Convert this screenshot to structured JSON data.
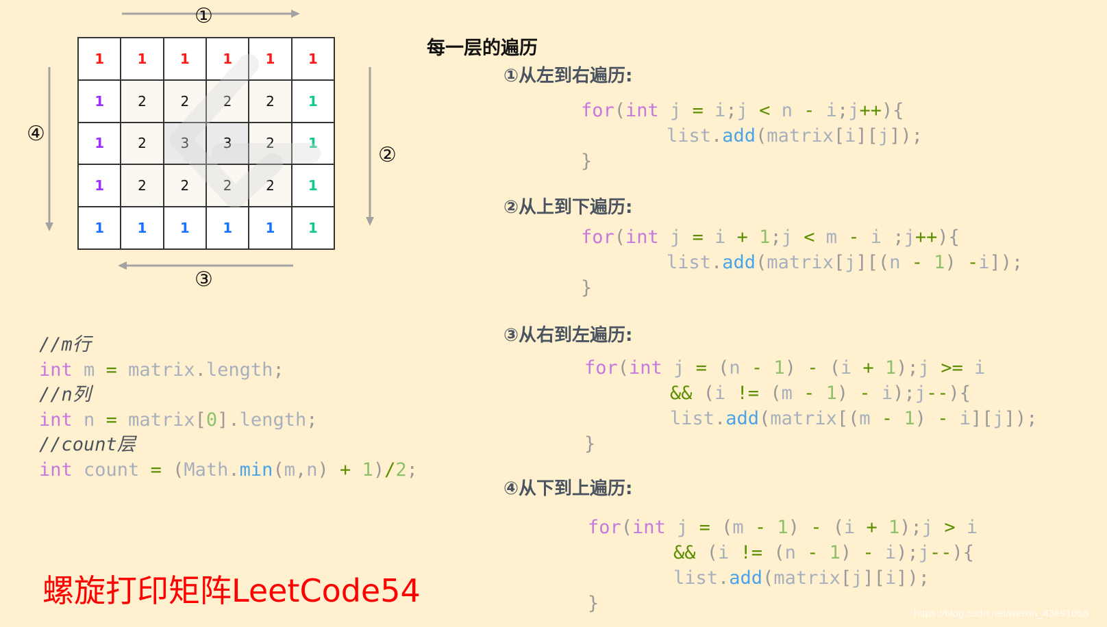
{
  "matrix": {
    "rows": [
      [
        1,
        1,
        1,
        1,
        1,
        1
      ],
      [
        1,
        2,
        2,
        2,
        2,
        1
      ],
      [
        1,
        2,
        3,
        3,
        2,
        1
      ],
      [
        1,
        2,
        2,
        2,
        2,
        1
      ],
      [
        1,
        1,
        1,
        1,
        1,
        1
      ]
    ],
    "colors": {
      "top": "#ff1a1a",
      "right": "#11c98a",
      "bottom": "#1a73ff",
      "left": "#9b30ff",
      "inner": "#111111"
    }
  },
  "arrows": {
    "top": {
      "label": "①",
      "direction": "right"
    },
    "right": {
      "label": "②",
      "direction": "down"
    },
    "bottom": {
      "label": "③",
      "direction": "left"
    },
    "left": {
      "label": "④",
      "direction": "down"
    }
  },
  "left_code": {
    "lines": [
      {
        "comment": "//m行"
      },
      {
        "tokens": [
          [
            "kw",
            "int"
          ],
          [
            "id",
            " m "
          ],
          [
            "op",
            "="
          ],
          [
            "id",
            " matrix"
          ],
          [
            "pn",
            "."
          ],
          [
            "id",
            "length"
          ],
          [
            "pn",
            ";"
          ]
        ]
      },
      {
        "comment": "//n列"
      },
      {
        "tokens": [
          [
            "kw",
            "int"
          ],
          [
            "id",
            " n "
          ],
          [
            "op",
            "="
          ],
          [
            "id",
            " matrix"
          ],
          [
            "pn",
            "["
          ],
          [
            "num",
            "0"
          ],
          [
            "pn",
            "]."
          ],
          [
            "id",
            "length"
          ],
          [
            "pn",
            ";"
          ]
        ]
      },
      {
        "comment": "//count层"
      },
      {
        "tokens": [
          [
            "kw",
            "int"
          ],
          [
            "id",
            " count "
          ],
          [
            "op",
            "="
          ],
          [
            "pn",
            " ("
          ],
          [
            "id",
            "Math"
          ],
          [
            "pn",
            "."
          ],
          [
            "fn",
            "min"
          ],
          [
            "pn",
            "("
          ],
          [
            "id",
            "m"
          ],
          [
            "pn",
            ","
          ],
          [
            "id",
            "n"
          ],
          [
            "pn",
            ")"
          ],
          [
            "op",
            " + "
          ],
          [
            "num",
            "1"
          ],
          [
            "pn",
            ")"
          ],
          [
            "op",
            "/"
          ],
          [
            "num",
            "2"
          ],
          [
            "pn",
            ";"
          ]
        ]
      }
    ]
  },
  "heading": "每一层的遍历",
  "sections": [
    {
      "title": "①从左到右遍历:",
      "lines": [
        [
          [
            "kw",
            "for"
          ],
          [
            "pn",
            "("
          ],
          [
            "kw",
            "int"
          ],
          [
            "id",
            " j "
          ],
          [
            "op",
            "="
          ],
          [
            "id",
            " i"
          ],
          [
            "pn",
            ";"
          ],
          [
            "id",
            "j "
          ],
          [
            "op",
            "<"
          ],
          [
            "id",
            " n "
          ],
          [
            "op",
            "-"
          ],
          [
            "id",
            " i"
          ],
          [
            "pn",
            ";"
          ],
          [
            "id",
            "j"
          ],
          [
            "op",
            "++"
          ],
          [
            "pn",
            "){"
          ]
        ],
        [
          [
            "id",
            "list"
          ],
          [
            "pn",
            "."
          ],
          [
            "fn",
            "add"
          ],
          [
            "pn",
            "("
          ],
          [
            "id",
            "matrix"
          ],
          [
            "pn",
            "["
          ],
          [
            "id",
            "i"
          ],
          [
            "pn",
            "]["
          ],
          [
            "id",
            "j"
          ],
          [
            "pn",
            "]);"
          ]
        ],
        [
          [
            "pn",
            "}"
          ]
        ]
      ]
    },
    {
      "title": "②从上到下遍历:",
      "lines": [
        [
          [
            "kw",
            "for"
          ],
          [
            "pn",
            "("
          ],
          [
            "kw",
            "int"
          ],
          [
            "id",
            " j "
          ],
          [
            "op",
            "="
          ],
          [
            "id",
            " i "
          ],
          [
            "op",
            "+"
          ],
          [
            "num",
            " 1"
          ],
          [
            "pn",
            ";"
          ],
          [
            "id",
            "j "
          ],
          [
            "op",
            "<"
          ],
          [
            "id",
            " m "
          ],
          [
            "op",
            "-"
          ],
          [
            "id",
            " i "
          ],
          [
            "pn",
            ";"
          ],
          [
            "id",
            "j"
          ],
          [
            "op",
            "++"
          ],
          [
            "pn",
            "){"
          ]
        ],
        [
          [
            "id",
            "list"
          ],
          [
            "pn",
            "."
          ],
          [
            "fn",
            "add"
          ],
          [
            "pn",
            "("
          ],
          [
            "id",
            "matrix"
          ],
          [
            "pn",
            "["
          ],
          [
            "id",
            "j"
          ],
          [
            "pn",
            "][("
          ],
          [
            "id",
            "n "
          ],
          [
            "op",
            "-"
          ],
          [
            "num",
            " 1"
          ],
          [
            "pn",
            ")"
          ],
          [
            "op",
            " -"
          ],
          [
            "id",
            "i"
          ],
          [
            "pn",
            "]);"
          ]
        ],
        [
          [
            "pn",
            "}"
          ]
        ]
      ]
    },
    {
      "title": "③从右到左遍历:",
      "lines": [
        [
          [
            "kw",
            "for"
          ],
          [
            "pn",
            "("
          ],
          [
            "kw",
            "int"
          ],
          [
            "id",
            " j "
          ],
          [
            "op",
            "="
          ],
          [
            "pn",
            " ("
          ],
          [
            "id",
            "n "
          ],
          [
            "op",
            "-"
          ],
          [
            "num",
            " 1"
          ],
          [
            "pn",
            ")"
          ],
          [
            "op",
            " - "
          ],
          [
            "pn",
            "("
          ],
          [
            "id",
            "i "
          ],
          [
            "op",
            "+"
          ],
          [
            "num",
            " 1"
          ],
          [
            "pn",
            ");"
          ],
          [
            "id",
            "j "
          ],
          [
            "op",
            ">="
          ],
          [
            "id",
            " i"
          ]
        ],
        [
          [
            "op",
            "&&"
          ],
          [
            "pn",
            " ("
          ],
          [
            "id",
            "i "
          ],
          [
            "op",
            "!="
          ],
          [
            "pn",
            " ("
          ],
          [
            "id",
            "m "
          ],
          [
            "op",
            "-"
          ],
          [
            "num",
            " 1"
          ],
          [
            "pn",
            ")"
          ],
          [
            "op",
            " - "
          ],
          [
            "id",
            "i"
          ],
          [
            "pn",
            ");"
          ],
          [
            "id",
            "j"
          ],
          [
            "op",
            "--"
          ],
          [
            "pn",
            "){"
          ]
        ],
        [
          [
            "id",
            "list"
          ],
          [
            "pn",
            "."
          ],
          [
            "fn",
            "add"
          ],
          [
            "pn",
            "("
          ],
          [
            "id",
            "matrix"
          ],
          [
            "pn",
            "[("
          ],
          [
            "id",
            "m "
          ],
          [
            "op",
            "-"
          ],
          [
            "num",
            " 1"
          ],
          [
            "pn",
            ")"
          ],
          [
            "op",
            " - "
          ],
          [
            "id",
            "i"
          ],
          [
            "pn",
            "]["
          ],
          [
            "id",
            "j"
          ],
          [
            "pn",
            "]);"
          ]
        ],
        [
          [
            "pn",
            "}"
          ]
        ]
      ]
    },
    {
      "title": "④从下到上遍历:",
      "lines": [
        [
          [
            "kw",
            "for"
          ],
          [
            "pn",
            "("
          ],
          [
            "kw",
            "int"
          ],
          [
            "id",
            " j "
          ],
          [
            "op",
            "="
          ],
          [
            "pn",
            " ("
          ],
          [
            "id",
            "m "
          ],
          [
            "op",
            "-"
          ],
          [
            "num",
            " 1"
          ],
          [
            "pn",
            ")"
          ],
          [
            "op",
            " - "
          ],
          [
            "pn",
            "("
          ],
          [
            "id",
            "i "
          ],
          [
            "op",
            "+"
          ],
          [
            "num",
            " 1"
          ],
          [
            "pn",
            ");"
          ],
          [
            "id",
            "j "
          ],
          [
            "op",
            ">"
          ],
          [
            "id",
            " i"
          ]
        ],
        [
          [
            "op",
            "&&"
          ],
          [
            "pn",
            " ("
          ],
          [
            "id",
            "i "
          ],
          [
            "op",
            "!="
          ],
          [
            "pn",
            " ("
          ],
          [
            "id",
            "n "
          ],
          [
            "op",
            "-"
          ],
          [
            "num",
            " 1"
          ],
          [
            "pn",
            ")"
          ],
          [
            "op",
            " - "
          ],
          [
            "id",
            "i"
          ],
          [
            "pn",
            ");"
          ],
          [
            "id",
            "j"
          ],
          [
            "op",
            "--"
          ],
          [
            "pn",
            "){"
          ]
        ],
        [
          [
            "id",
            "list"
          ],
          [
            "pn",
            "."
          ],
          [
            "fn",
            "add"
          ],
          [
            "pn",
            "("
          ],
          [
            "id",
            "matrix"
          ],
          [
            "pn",
            "["
          ],
          [
            "id",
            "j"
          ],
          [
            "pn",
            "]["
          ],
          [
            "id",
            "i"
          ],
          [
            "pn",
            "]);"
          ]
        ],
        [
          [
            "pn",
            "}"
          ]
        ]
      ]
    }
  ],
  "title": "螺旋打印矩阵LeetCode54",
  "credit": "https://blog.csdn.net/weixin_43691058"
}
